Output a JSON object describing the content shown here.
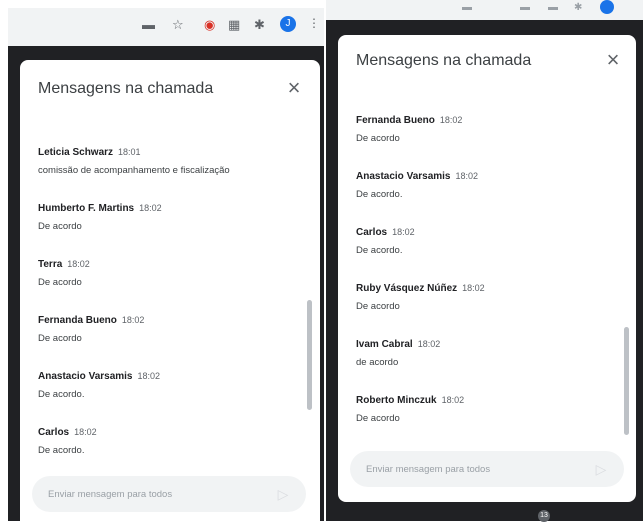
{
  "left_panel": {
    "title": "Mensagens na chamada",
    "close_icon": "×",
    "messages": [
      {
        "sender": "Leticia Schwarz",
        "time": "18:01",
        "text": "comissão de acompanhamento e fiscalização"
      },
      {
        "sender": "Humberto F. Martins",
        "time": "18:02",
        "text": "De acordo"
      },
      {
        "sender": "Terra",
        "time": "18:02",
        "text": "De acordo"
      },
      {
        "sender": "Fernanda Bueno",
        "time": "18:02",
        "text": "De acordo"
      },
      {
        "sender": "Anastacio Varsamis",
        "time": "18:02",
        "text": "De acordo."
      },
      {
        "sender": "Carlos",
        "time": "18:02",
        "text": "De acordo."
      }
    ],
    "input_placeholder": "Enviar mensagem para todos"
  },
  "right_panel": {
    "title": "Mensagens na chamada",
    "close_icon": "×",
    "messages": [
      {
        "sender": "Fernanda Bueno",
        "time": "18:02",
        "text": "De acordo"
      },
      {
        "sender": "Anastacio Varsamis",
        "time": "18:02",
        "text": "De acordo."
      },
      {
        "sender": "Carlos",
        "time": "18:02",
        "text": "De acordo."
      },
      {
        "sender": "Ruby Vásquez Núñez",
        "time": "18:02",
        "text": "De acordo"
      },
      {
        "sender": "Ivam Cabral",
        "time": "18:02",
        "text": "de acordo"
      },
      {
        "sender": "Roberto Minczuk",
        "time": "18:02",
        "text": "De acordo"
      }
    ],
    "input_placeholder": "Enviar mensagem para todos"
  },
  "toolbar": {
    "avatar_letter": "J",
    "kebab": "⋮"
  },
  "badge": "13",
  "colors": {
    "dark_background": "#202124",
    "panel": "#ffffff",
    "input": "#f1f3f4",
    "accent": "#1a73e8"
  },
  "icons": [
    "extension-icon",
    "star-icon",
    "shield-icon",
    "cast-icon",
    "puzzle-icon",
    "avatar",
    "kebab-menu-icon",
    "close-icon",
    "send-icon"
  ]
}
